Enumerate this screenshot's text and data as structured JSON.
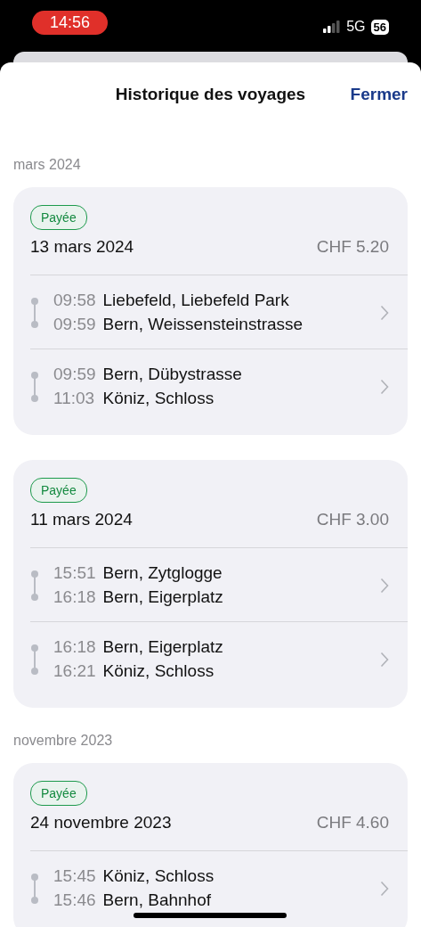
{
  "status_bar": {
    "time": "14:56",
    "network": "5G",
    "battery": "56"
  },
  "header": {
    "title": "Historique des voyages",
    "close": "Fermer"
  },
  "sections": [
    {
      "month": "mars 2024",
      "trips": [
        {
          "status": "Payée",
          "date": "13 mars 2024",
          "price": "CHF 5.20",
          "legs": [
            {
              "from_time": "09:58",
              "from": "Liebefeld, Liebefeld Park",
              "to_time": "09:59",
              "to": "Bern, Weissensteinstrasse"
            },
            {
              "from_time": "09:59",
              "from": "Bern, Dübystrasse",
              "to_time": "11:03",
              "to": "Köniz, Schloss"
            }
          ]
        },
        {
          "status": "Payée",
          "date": "11 mars 2024",
          "price": "CHF 3.00",
          "legs": [
            {
              "from_time": "15:51",
              "from": "Bern, Zytglogge",
              "to_time": "16:18",
              "to": "Bern, Eigerplatz"
            },
            {
              "from_time": "16:18",
              "from": "Bern, Eigerplatz",
              "to_time": "16:21",
              "to": "Köniz, Schloss"
            }
          ]
        }
      ]
    },
    {
      "month": "novembre 2023",
      "trips": [
        {
          "status": "Payée",
          "date": "24 novembre 2023",
          "price": "CHF 4.60",
          "legs": [
            {
              "from_time": "15:45",
              "from": "Köniz, Schloss",
              "to_time": "15:46",
              "to": "Bern, Bahnhof"
            }
          ]
        }
      ]
    }
  ]
}
